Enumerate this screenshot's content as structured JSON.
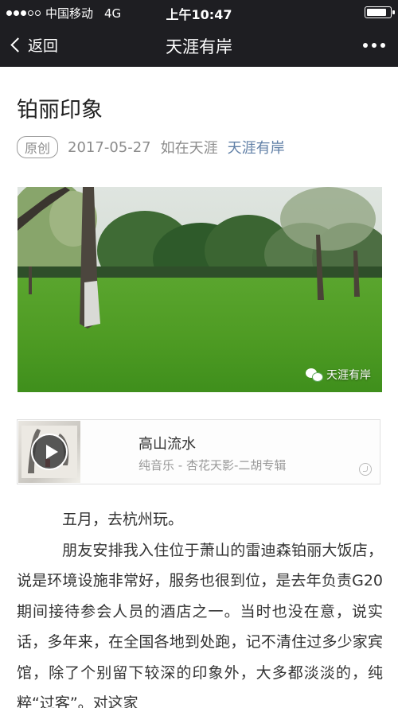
{
  "status_bar": {
    "carrier": "中国移动",
    "network": "4G",
    "time": "上午10:47",
    "signal_strength": 3,
    "battery_level": 0.9
  },
  "nav": {
    "back_label": "返回",
    "title": "天涯有岸",
    "more_icon": "more-dots-icon"
  },
  "article": {
    "title": "铂丽印象",
    "badge": "原创",
    "date": "2017-05-27",
    "author": "如在天涯",
    "account": "天涯有岸",
    "account_color": "#607fa6"
  },
  "photo": {
    "watermark": "天涯有岸"
  },
  "music": {
    "title": "高山流水",
    "subtitle": "纯音乐 - 杏花天影-二胡专辑"
  },
  "paragraphs": [
    "五月，去杭州玩。",
    "朋友安排我入住位于萧山的雷迪森铂丽大饭店，说是环境设施非常好，服务也很到位，是去年负责G20期间接待参会人员的酒店之一。当时也没在意，说实话，多年来，在全国各地到处跑，记不清住过多少家宾馆，除了个别留下较深的印象外，大多都淡淡的，纯粹“过客”。对这家"
  ]
}
